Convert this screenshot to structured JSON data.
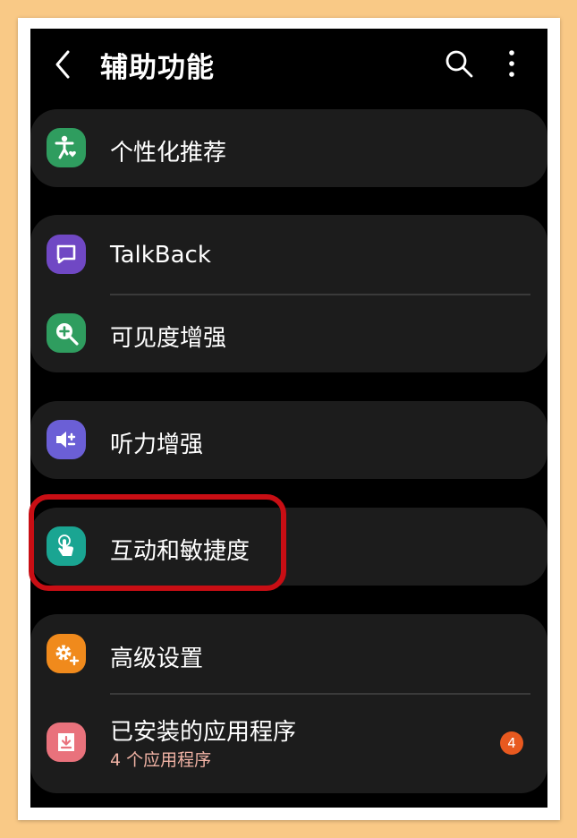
{
  "header": {
    "title": "辅助功能"
  },
  "items": [
    {
      "label": "个性化推荐",
      "icon": "accessibility-person-heart-icon",
      "color": "#2f9d5f"
    },
    {
      "label": "TalkBack",
      "icon": "talkback-message-icon",
      "color": "#7048c4"
    },
    {
      "label": "可见度增强",
      "icon": "magnifier-plus-icon",
      "color": "#2f9d5f"
    },
    {
      "label": "听力增强",
      "icon": "speaker-plus-minus-icon",
      "color": "#6b5fd6"
    },
    {
      "label": "互动和敏捷度",
      "icon": "touch-hand-icon",
      "color": "#1aa592"
    },
    {
      "label": "高级设置",
      "icon": "gear-plus-icon",
      "color": "#f08a1c"
    },
    {
      "label": "已安装的应用程序",
      "sublabel": "4 个应用程序",
      "icon": "download-tray-icon",
      "color": "#e9727c",
      "badge": "4"
    }
  ],
  "colors": {
    "background": "#000000",
    "card": "#1c1c1c",
    "highlight": "#c80e14",
    "badge": "#e8591f",
    "sublabel": "#f0b2a4"
  }
}
